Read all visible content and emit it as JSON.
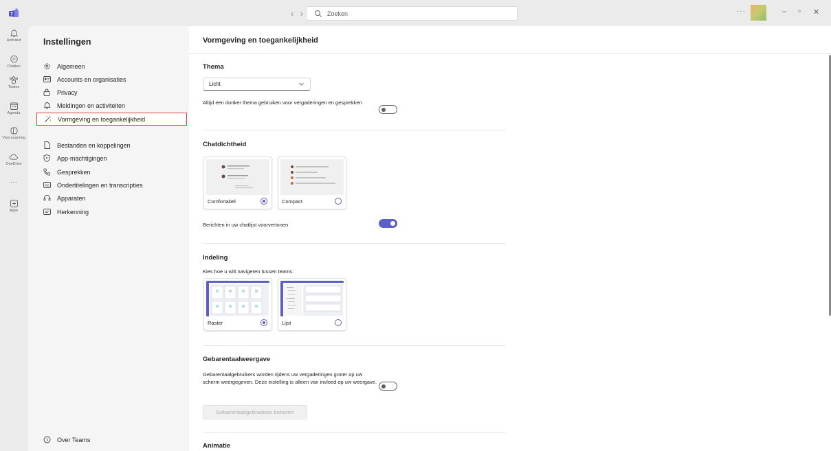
{
  "search": {
    "placeholder": "Zoeken"
  },
  "titlebar": {
    "more": "···"
  },
  "rail": [
    {
      "label": "Activiteit",
      "icon": "bell-icon"
    },
    {
      "label": "Chatten",
      "icon": "chat-icon"
    },
    {
      "label": "Teams",
      "icon": "teams-icon"
    },
    {
      "label": "Agenda",
      "icon": "calendar-icon"
    },
    {
      "label": "Viva Learning",
      "icon": "viva-learning-icon"
    },
    {
      "label": "OneDrive",
      "icon": "cloud-icon"
    },
    {
      "label": "Apps",
      "icon": "apps-icon"
    }
  ],
  "sidebar": {
    "title": "Instellingen",
    "items": [
      {
        "label": "Algemeen",
        "icon": "gear-icon"
      },
      {
        "label": "Accounts en organisaties",
        "icon": "id-card-icon"
      },
      {
        "label": "Privacy",
        "icon": "lock-icon"
      },
      {
        "label": "Meldingen en activiteiten",
        "icon": "bell-icon"
      },
      {
        "label": "Vormgeving en toegankelijkheid",
        "icon": "magic-wand-icon",
        "active": true
      },
      {
        "label": "Bestanden en koppelingen",
        "icon": "file-icon"
      },
      {
        "label": "App-machtigingen",
        "icon": "shield-icon"
      },
      {
        "label": "Gesprekken",
        "icon": "phone-icon"
      },
      {
        "label": "Ondertitelingen en transcripties",
        "icon": "cc-icon"
      },
      {
        "label": "Apparaten",
        "icon": "headset-icon"
      },
      {
        "label": "Herkenning",
        "icon": "recognition-icon"
      }
    ],
    "footer": "Over Teams"
  },
  "main": {
    "title": "Vormgeving en toegankelijkheid",
    "thema": {
      "title": "Thema",
      "select_value": "Licht",
      "dark_theme_label": "Altijd een donker thema gebruiken voor vergaderingen en gesprekken",
      "dark_theme_on": false
    },
    "chatdichtheid": {
      "title": "Chatdichtheid",
      "options": [
        {
          "label": "Comfortabel",
          "selected": true
        },
        {
          "label": "Compact",
          "selected": false
        }
      ],
      "preview_label": "Berichten in uw chatlijst voorvertonen",
      "preview_on": true
    },
    "indeling": {
      "title": "Indeling",
      "description": "Kies hoe u wilt navigeren tussen teams.",
      "options": [
        {
          "label": "Raster",
          "selected": true
        },
        {
          "label": "Lijst",
          "selected": false
        }
      ]
    },
    "gebarentaal": {
      "title": "Gebarentaalweergave",
      "description": "Gebarentaalgebruikers worden tijdens uw vergaderingen groter op uw scherm weergegeven. Deze instelling is alleen van invloed op uw weergave.",
      "toggle_on": false,
      "button": "Gebarentaalgebruikers beheren"
    },
    "animatie": {
      "title": "Animatie"
    }
  },
  "colors": {
    "accent": "#5b5fc7",
    "highlight": "#e8403b"
  }
}
